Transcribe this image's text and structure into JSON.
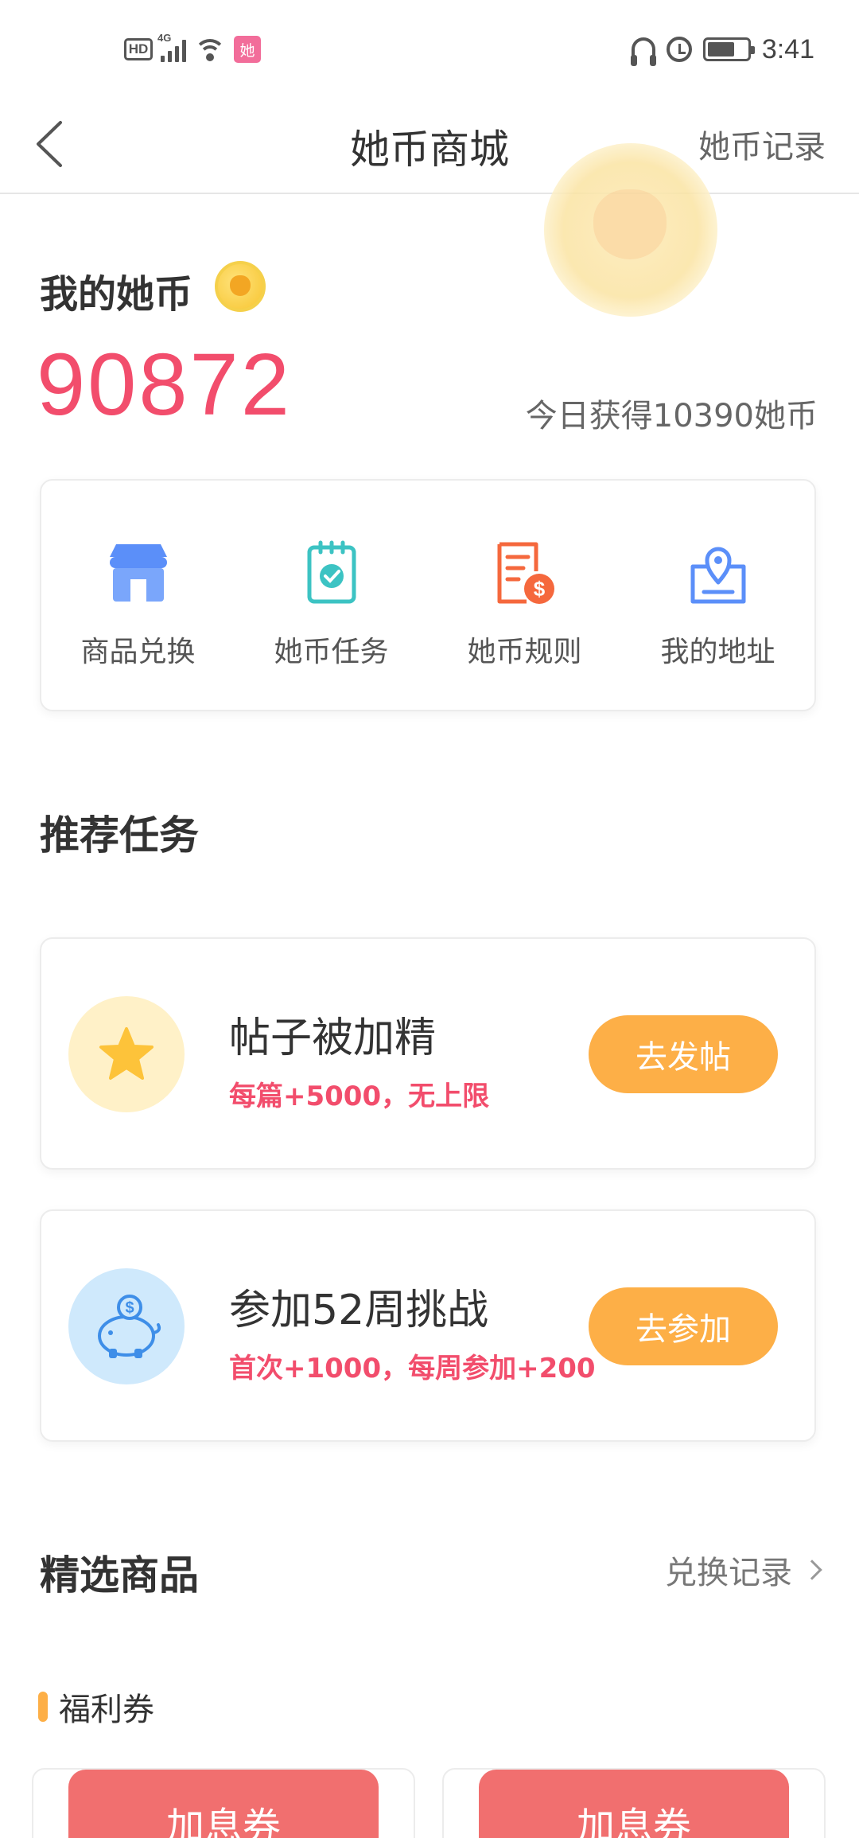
{
  "status_bar": {
    "hd_label": "HD",
    "network_label": "4G",
    "app_badge": "她",
    "time": "3:41",
    "battery_level": 0.7
  },
  "nav": {
    "title": "她币商城",
    "right_link": "她币记录"
  },
  "balance": {
    "label": "我的她币",
    "amount": "90872",
    "today_earned": "今日获得10390她币"
  },
  "menu": [
    {
      "label": "商品兑换",
      "icon": "store-icon"
    },
    {
      "label": "她币任务",
      "icon": "task-clipboard-icon"
    },
    {
      "label": "她币规则",
      "icon": "rules-document-icon"
    },
    {
      "label": "我的地址",
      "icon": "address-pin-icon"
    }
  ],
  "recommended": {
    "title": "推荐任务",
    "tasks": [
      {
        "title": "帖子被加精",
        "desc": "每篇+5000，无上限",
        "button": "去发帖",
        "icon": "star-icon"
      },
      {
        "title": "参加52周挑战",
        "desc": "首次+1000，每周参加+200",
        "button": "去参加",
        "icon": "piggy-bank-icon"
      }
    ]
  },
  "products": {
    "title": "精选商品",
    "exchange_link": "兑换记录",
    "category": "福利券",
    "items": [
      {
        "label": "加息券"
      },
      {
        "label": "加息券"
      }
    ]
  },
  "colors": {
    "accent_pink": "#f24d6c",
    "button_orange": "#fdaf47",
    "ticket_red": "#f16f6f",
    "icon_blue": "#5b8ff9",
    "icon_teal": "#3cc3c3",
    "icon_orange": "#f5683d"
  }
}
